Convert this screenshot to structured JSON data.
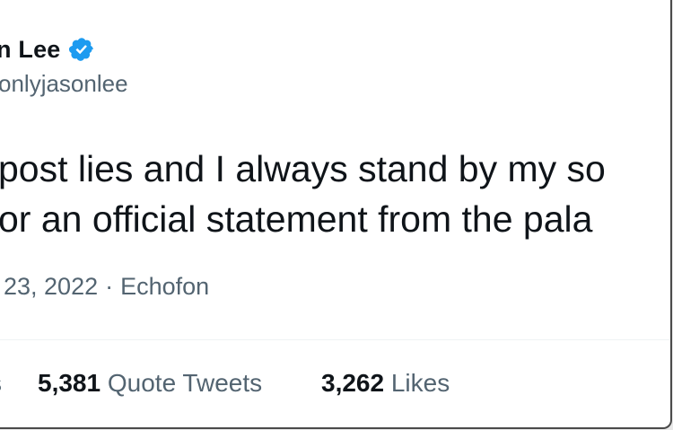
{
  "author": {
    "display_name": "n Lee",
    "handle": "onlyjasonlee",
    "verified_icon": "verified-badge-icon",
    "verified_color": "#1d9bf0"
  },
  "tweet": {
    "lines": [
      "post lies and I always stand by my so",
      "or an official statement from the pala"
    ]
  },
  "meta": {
    "date": "23, 2022",
    "separator": "·",
    "source": "Echofon"
  },
  "stats": {
    "retweets_label_fragment": "s",
    "quote_tweets_count": "5,381",
    "quote_tweets_label": "Quote Tweets",
    "likes_count": "3,262",
    "likes_label": "Likes"
  }
}
